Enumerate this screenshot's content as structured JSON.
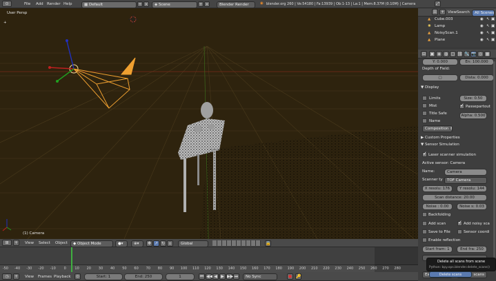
{
  "topbar": {
    "menus": [
      "File",
      "Add",
      "Render",
      "Help"
    ],
    "layout": "Default",
    "scene": "Scene",
    "engine": "Blender Render",
    "info": "blender.org 260 | Ve:54180 | Fa:13939 | Ob:1-13 | La:1 | Mem:8.37M (0.10M) | Camera"
  },
  "viewport": {
    "title": "User Persp",
    "object_label": "(1) Camera",
    "bg_color": "#2f2410"
  },
  "viewport_header": {
    "menus": [
      "View",
      "Select",
      "Object"
    ],
    "mode": "Object Mode",
    "orientation": "Global"
  },
  "outliner": {
    "menus": [
      "View",
      "Search"
    ],
    "filter": "All Scenes",
    "items": [
      "Cube.003",
      "Lamp",
      "NoisyScan.1",
      "Plane"
    ]
  },
  "properties": {
    "clip_start": "Y: 0.000",
    "clip_end": "En: 100.000",
    "dof_label": "Depth of Field:",
    "dof_dist": "Dista: 0.000",
    "display_header": "Display",
    "limits": "Limits",
    "size": "Size: 0.50",
    "mist": "Mist",
    "passepartout": "Passepartout",
    "title_safe": "Title Safe",
    "alpha": "Alpha: 0.500",
    "name": "Name",
    "composition": "Composition",
    "custom_props": "Custom Properties",
    "sensor_sim": "Sensor Simulation",
    "laser_sim": "Laser scanner simulation",
    "active_sensor": "Active sensor: Camera",
    "name_label": "Name:",
    "name_value": "Camera",
    "scanner_label": "Scanner ty",
    "scanner_value": "TOF Camera",
    "x_res": "X resolu: 176",
    "y_res": "Y resolu: 144",
    "scan_dist": "Scan distance: 20.00",
    "noise1": "Noise : 0.00",
    "noise2": "Noise s: 0.03",
    "backfolding": "Backfolding",
    "add_scan": "Add scan",
    "add_noisy": "Add noisy sca",
    "save_file": "Save to File",
    "sensor_coord": "Sensor coordi",
    "enable_refl": "Enable reflection",
    "start_frame": "Start fram: 1",
    "end_frame": "End fra: 250",
    "expo": "Expo",
    "scans": "scans"
  },
  "tooltip": {
    "line1": "Delete all scans from scene",
    "line2": "Python: bpy.ops.blender.delete_scans()",
    "button": "Delete scans"
  },
  "timeline": {
    "ticks": [
      "-50",
      "-40",
      "-30",
      "-20",
      "-10",
      "0",
      "10",
      "20",
      "30",
      "40",
      "50",
      "60",
      "70",
      "80",
      "90",
      "100",
      "110",
      "120",
      "130",
      "140",
      "150",
      "160",
      "170",
      "180",
      "190",
      "200",
      "210",
      "220",
      "230",
      "240",
      "250",
      "260",
      "270",
      "280"
    ]
  },
  "timeline_header": {
    "menus": [
      "View",
      "Frames",
      "Playback"
    ],
    "start": "Start: 1",
    "end": "End: 250",
    "current": "1",
    "sync": "No Sync"
  }
}
